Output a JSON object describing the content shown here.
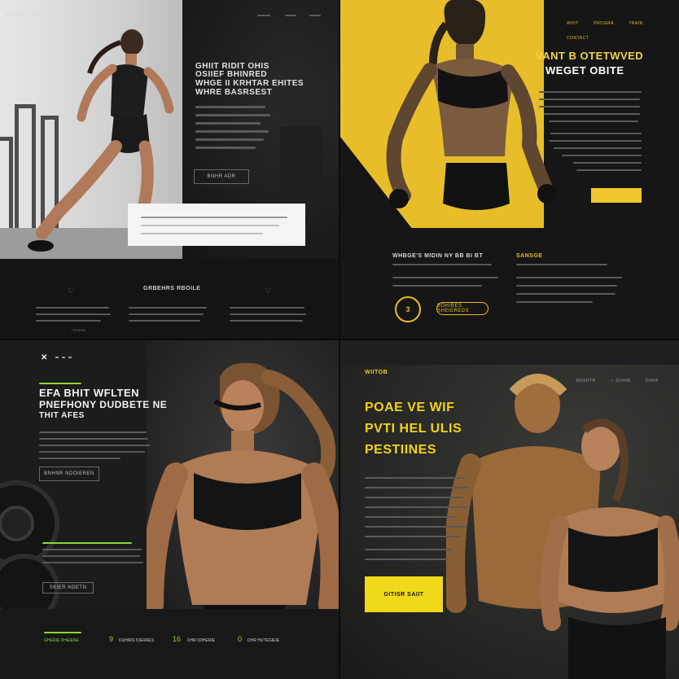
{
  "q1": {
    "logo": "EHRED OWE",
    "nav": [
      "",
      "",
      ""
    ],
    "headline": [
      "GHIIT RIDIT OHIS",
      "OSIIEF BHINRED",
      "WHGE II KRHTAR EHITES",
      "WHRE BASRSEST"
    ],
    "button": "BNHR ADR",
    "section_title": "GRBEHRS RBOILE",
    "footer_link": "ITRSEIIN"
  },
  "q2": {
    "nav": [
      "WHIT",
      "PROGRA",
      "TRAIN",
      "CONTACT"
    ],
    "headline": [
      "VANT B OTETWVED",
      "WEGET OBITE"
    ],
    "button": "",
    "section1_title": "WHBGE'S MIDIN NY BB BI BT",
    "section2_title": "SANSGE",
    "badge": "3",
    "button2": "BOHIRES SHEIEREDS"
  },
  "q3": {
    "logo_mark": "✕",
    "headline": [
      "EFA BHIT WFLTEN",
      "PNEFHONY DUDBETE NE",
      "THIT AFES"
    ],
    "button1": "BNHNR NDOIEREN",
    "button2": "SKIER NDETN",
    "stats": [
      {
        "num": "",
        "label": "GHERIE DHEIENE"
      },
      {
        "num": "9",
        "label": "DUHIRS IOERRES"
      },
      {
        "num": "16",
        "label": "DHR IOIHERIE"
      },
      {
        "num": "0",
        "label": "DHR HUTEGIEIE"
      }
    ]
  },
  "q4": {
    "logo": "WIITOB",
    "nav": [
      "BHSHTB",
      "✓ DUHIB",
      "DIHIB"
    ],
    "headline": [
      "POAE VE WIF",
      "PVTI HEL ULIS",
      "PESTIINES"
    ],
    "button": "GITISR SAIIT"
  },
  "colors": {
    "yellow": "#e7be2a",
    "lime": "#8bd43a",
    "dark": "#141414"
  }
}
